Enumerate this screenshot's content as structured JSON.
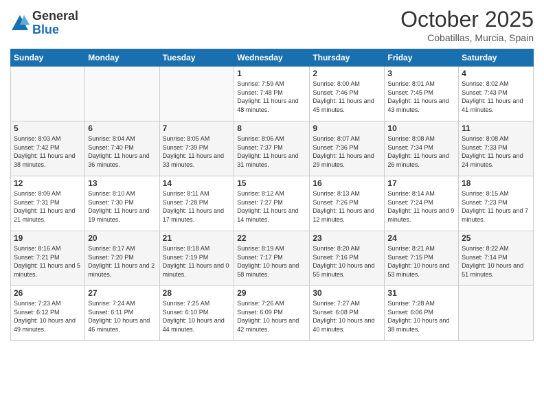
{
  "header": {
    "logo_general": "General",
    "logo_blue": "Blue",
    "month_title": "October 2025",
    "subtitle": "Cobatillas, Murcia, Spain"
  },
  "days_of_week": [
    "Sunday",
    "Monday",
    "Tuesday",
    "Wednesday",
    "Thursday",
    "Friday",
    "Saturday"
  ],
  "weeks": [
    [
      {
        "day": "",
        "info": ""
      },
      {
        "day": "",
        "info": ""
      },
      {
        "day": "",
        "info": ""
      },
      {
        "day": "1",
        "info": "Sunrise: 7:59 AM\nSunset: 7:48 PM\nDaylight: 11 hours and 48 minutes."
      },
      {
        "day": "2",
        "info": "Sunrise: 8:00 AM\nSunset: 7:46 PM\nDaylight: 11 hours and 45 minutes."
      },
      {
        "day": "3",
        "info": "Sunrise: 8:01 AM\nSunset: 7:45 PM\nDaylight: 11 hours and 43 minutes."
      },
      {
        "day": "4",
        "info": "Sunrise: 8:02 AM\nSunset: 7:43 PM\nDaylight: 11 hours and 41 minutes."
      }
    ],
    [
      {
        "day": "5",
        "info": "Sunrise: 8:03 AM\nSunset: 7:42 PM\nDaylight: 11 hours and 38 minutes."
      },
      {
        "day": "6",
        "info": "Sunrise: 8:04 AM\nSunset: 7:40 PM\nDaylight: 11 hours and 36 minutes."
      },
      {
        "day": "7",
        "info": "Sunrise: 8:05 AM\nSunset: 7:39 PM\nDaylight: 11 hours and 33 minutes."
      },
      {
        "day": "8",
        "info": "Sunrise: 8:06 AM\nSunset: 7:37 PM\nDaylight: 11 hours and 31 minutes."
      },
      {
        "day": "9",
        "info": "Sunrise: 8:07 AM\nSunset: 7:36 PM\nDaylight: 11 hours and 29 minutes."
      },
      {
        "day": "10",
        "info": "Sunrise: 8:08 AM\nSunset: 7:34 PM\nDaylight: 11 hours and 26 minutes."
      },
      {
        "day": "11",
        "info": "Sunrise: 8:08 AM\nSunset: 7:33 PM\nDaylight: 11 hours and 24 minutes."
      }
    ],
    [
      {
        "day": "12",
        "info": "Sunrise: 8:09 AM\nSunset: 7:31 PM\nDaylight: 11 hours and 21 minutes."
      },
      {
        "day": "13",
        "info": "Sunrise: 8:10 AM\nSunset: 7:30 PM\nDaylight: 11 hours and 19 minutes."
      },
      {
        "day": "14",
        "info": "Sunrise: 8:11 AM\nSunset: 7:28 PM\nDaylight: 11 hours and 17 minutes."
      },
      {
        "day": "15",
        "info": "Sunrise: 8:12 AM\nSunset: 7:27 PM\nDaylight: 11 hours and 14 minutes."
      },
      {
        "day": "16",
        "info": "Sunrise: 8:13 AM\nSunset: 7:26 PM\nDaylight: 11 hours and 12 minutes."
      },
      {
        "day": "17",
        "info": "Sunrise: 8:14 AM\nSunset: 7:24 PM\nDaylight: 11 hours and 9 minutes."
      },
      {
        "day": "18",
        "info": "Sunrise: 8:15 AM\nSunset: 7:23 PM\nDaylight: 11 hours and 7 minutes."
      }
    ],
    [
      {
        "day": "19",
        "info": "Sunrise: 8:16 AM\nSunset: 7:21 PM\nDaylight: 11 hours and 5 minutes."
      },
      {
        "day": "20",
        "info": "Sunrise: 8:17 AM\nSunset: 7:20 PM\nDaylight: 11 hours and 2 minutes."
      },
      {
        "day": "21",
        "info": "Sunrise: 8:18 AM\nSunset: 7:19 PM\nDaylight: 11 hours and 0 minutes."
      },
      {
        "day": "22",
        "info": "Sunrise: 8:19 AM\nSunset: 7:17 PM\nDaylight: 10 hours and 58 minutes."
      },
      {
        "day": "23",
        "info": "Sunrise: 8:20 AM\nSunset: 7:16 PM\nDaylight: 10 hours and 55 minutes."
      },
      {
        "day": "24",
        "info": "Sunrise: 8:21 AM\nSunset: 7:15 PM\nDaylight: 10 hours and 53 minutes."
      },
      {
        "day": "25",
        "info": "Sunrise: 8:22 AM\nSunset: 7:14 PM\nDaylight: 10 hours and 51 minutes."
      }
    ],
    [
      {
        "day": "26",
        "info": "Sunrise: 7:23 AM\nSunset: 6:12 PM\nDaylight: 10 hours and 49 minutes."
      },
      {
        "day": "27",
        "info": "Sunrise: 7:24 AM\nSunset: 6:11 PM\nDaylight: 10 hours and 46 minutes."
      },
      {
        "day": "28",
        "info": "Sunrise: 7:25 AM\nSunset: 6:10 PM\nDaylight: 10 hours and 44 minutes."
      },
      {
        "day": "29",
        "info": "Sunrise: 7:26 AM\nSunset: 6:09 PM\nDaylight: 10 hours and 42 minutes."
      },
      {
        "day": "30",
        "info": "Sunrise: 7:27 AM\nSunset: 6:08 PM\nDaylight: 10 hours and 40 minutes."
      },
      {
        "day": "31",
        "info": "Sunrise: 7:28 AM\nSunset: 6:06 PM\nDaylight: 10 hours and 38 minutes."
      },
      {
        "day": "",
        "info": ""
      }
    ]
  ]
}
